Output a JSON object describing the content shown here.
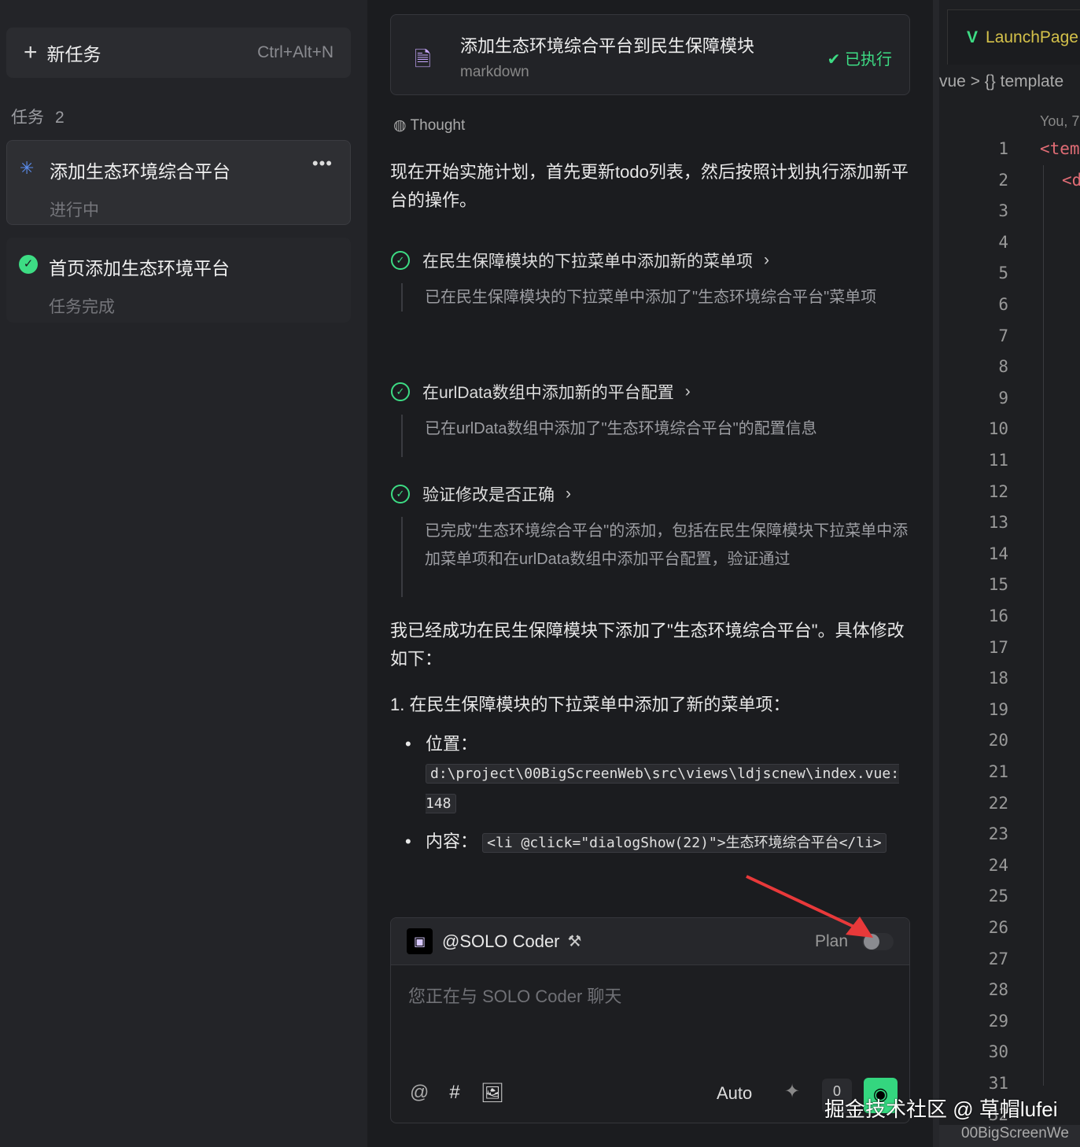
{
  "sidebar": {
    "new_task": "新任务",
    "shortcut": "Ctrl+Alt+N",
    "tasks_label": "任务",
    "tasks_count": "2",
    "tasks": [
      {
        "title": "添加生态环境综合平台",
        "status": "进行中"
      },
      {
        "title": "首页添加生态环境平台",
        "status": "任务完成"
      }
    ]
  },
  "main": {
    "file": {
      "name": "添加生态环境综合平台到民生保障模块",
      "type": "markdown",
      "status": "已执行"
    },
    "thought": "Thought",
    "intro": "现在开始实施计划，首先更新todo列表，然后按照计划执行添加新平台的操作。",
    "steps": [
      {
        "title": "在民生保障模块的下拉菜单中添加新的菜单项",
        "detail": "已在民生保障模块的下拉菜单中添加了\"生态环境综合平台\"菜单项"
      },
      {
        "title": "在urlData数组中添加新的平台配置",
        "detail": "已在urlData数组中添加了\"生态环境综合平台\"的配置信息"
      },
      {
        "title": "验证修改是否正确",
        "detail": "已完成\"生态环境综合平台\"的添加，包括在民生保障模块下拉菜单中添加菜单项和在urlData数组中添加平台配置，验证通过"
      }
    ],
    "summary": "我已经成功在民生保障模块下添加了\"生态环境综合平台\"。具体修改如下：",
    "item1": "1. 在民生保障模块的下拉菜单中添加了新的菜单项：",
    "pos_label": "位置：",
    "pos_code": "d:\\project\\00BigScreenWeb\\src\\views\\ldjscnew\\index.vue:148",
    "content_label": "内容：",
    "content_code": "<li @click=\"dialogShow(22)\">生态环境综合平台</li>"
  },
  "chat": {
    "agent": "@SOLO Coder",
    "plan_label": "Plan",
    "plan_enabled": false,
    "placeholder": "您正在与 SOLO Coder 聊天",
    "mode": "Auto",
    "count": "0"
  },
  "editor": {
    "tab": "LaunchPage",
    "breadcrumb": "vue > {} template",
    "blame": "You, 7",
    "line1": "<tem",
    "line2": "<d",
    "line_numbers": [
      "1",
      "2",
      "3",
      "4",
      "5",
      "6",
      "7",
      "8",
      "9",
      "10",
      "11",
      "12",
      "13",
      "14",
      "15",
      "16",
      "17",
      "18",
      "19",
      "20",
      "21",
      "22",
      "23",
      "24",
      "25",
      "26",
      "27",
      "28",
      "29",
      "30",
      "31",
      "32"
    ],
    "status": "00BigScreenWe"
  },
  "watermark": "掘金技术社区 @ 草帽lufei",
  "colors": {
    "accent_green": "#3ddc84",
    "arrow_red": "#e8393a"
  }
}
